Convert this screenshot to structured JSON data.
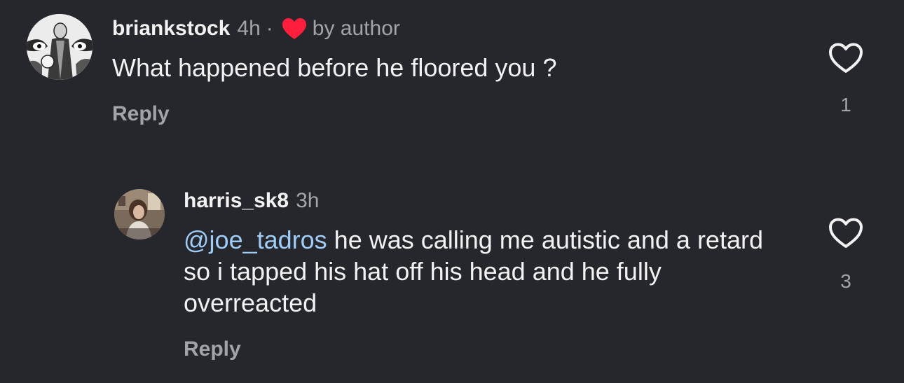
{
  "comments": [
    {
      "username": "briankstock",
      "time": "4h",
      "separator": "·",
      "liked_by_author_label": "by author",
      "text": "What happened before he floored you ?",
      "reply_label": "Reply",
      "like_count": "1",
      "avatar_icon": "illustrated-figure-avatar"
    },
    {
      "username": "harris_sk8",
      "time": "3h",
      "mention": "@joe_tadros",
      "text": " he was calling me autistic and a retard so i tapped his hat off his head and he fully overreacted",
      "reply_label": "Reply",
      "like_count": "3",
      "avatar_icon": "photo-avatar"
    }
  ],
  "colors": {
    "background": "#25272c",
    "primary_text": "#f2f2f2",
    "secondary_text": "#a2a4a8",
    "mention": "#9fcdf7",
    "author_heart": "#ff1f3d"
  }
}
